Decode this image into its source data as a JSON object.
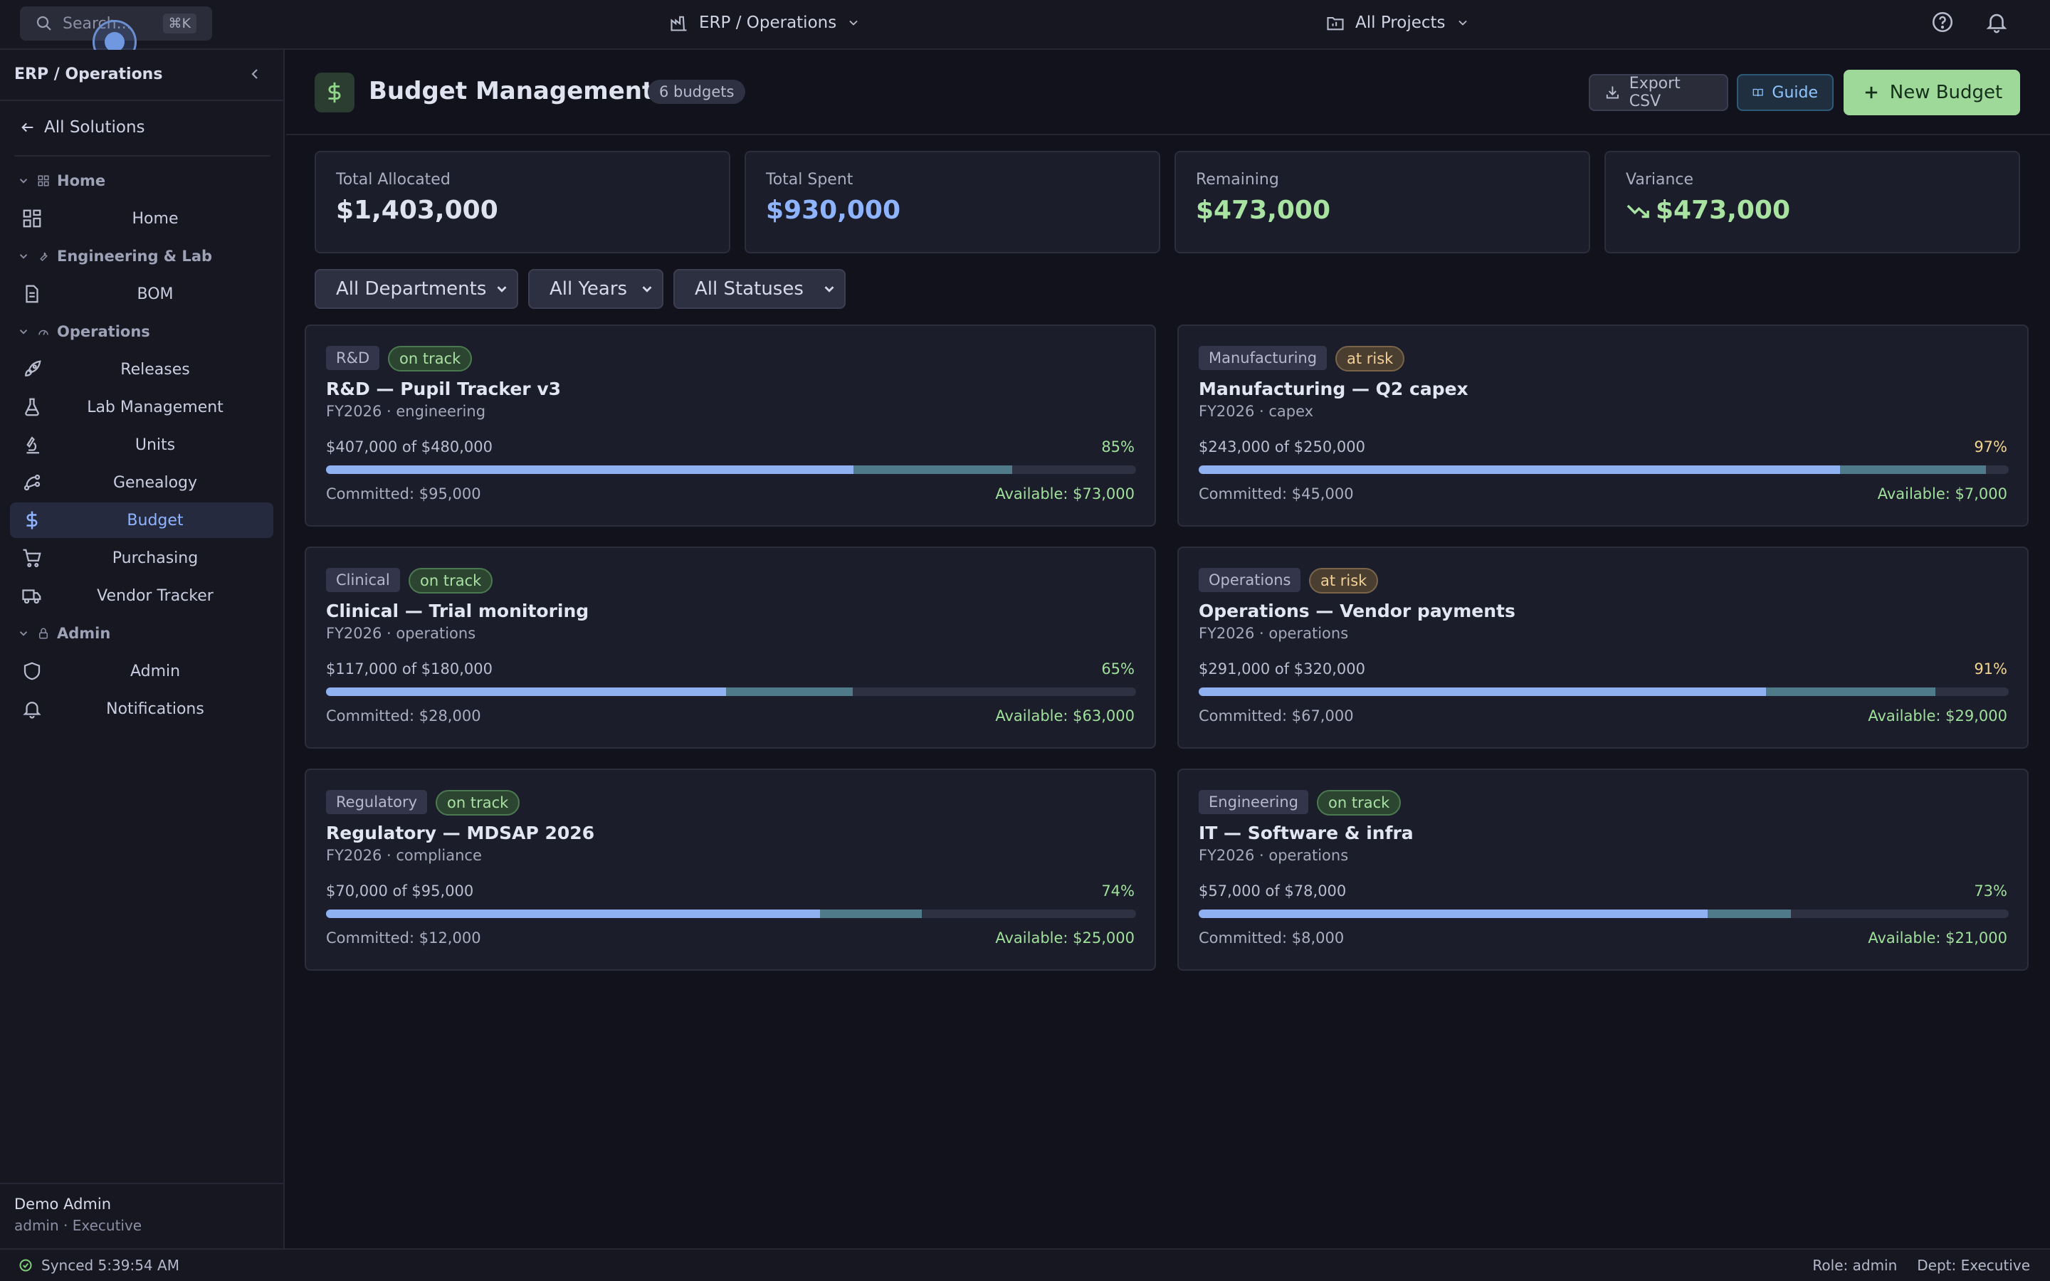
{
  "topbar": {
    "search_placeholder": "Search...",
    "search_shortcut": "⌘K",
    "solution_switcher": "ERP / Operations",
    "project_switcher": "All Projects"
  },
  "sidebar": {
    "title": "ERP / Operations",
    "back_label": "All Solutions",
    "groups": [
      {
        "label": "Home",
        "items": [
          {
            "label": "Home",
            "icon": "grid-icon"
          }
        ]
      },
      {
        "label": "Engineering & Lab",
        "items": [
          {
            "label": "BOM",
            "icon": "document-icon"
          }
        ]
      },
      {
        "label": "Operations",
        "items": [
          {
            "label": "Releases",
            "icon": "rocket-icon"
          },
          {
            "label": "Lab Management",
            "icon": "flask-icon"
          },
          {
            "label": "Units",
            "icon": "microscope-icon"
          },
          {
            "label": "Genealogy",
            "icon": "branch-icon"
          },
          {
            "label": "Budget",
            "icon": "dollar-icon",
            "active": true
          },
          {
            "label": "Purchasing",
            "icon": "cart-icon"
          },
          {
            "label": "Vendor Tracker",
            "icon": "truck-icon"
          }
        ]
      },
      {
        "label": "Admin",
        "items": [
          {
            "label": "Admin",
            "icon": "shield-icon"
          },
          {
            "label": "Notifications",
            "icon": "bell-icon"
          }
        ]
      }
    ],
    "user": {
      "name": "Demo Admin",
      "role": "admin · Executive"
    }
  },
  "header": {
    "title": "Budget Management",
    "count_badge": "6 budgets",
    "export_label": "Export CSV",
    "guide_label": "Guide",
    "new_label": "New Budget"
  },
  "stats": [
    {
      "label": "Total Allocated",
      "value": "$1,403,000",
      "color": "#dfe3f0"
    },
    {
      "label": "Total Spent",
      "value": "$930,000",
      "color": "#8fb4ff"
    },
    {
      "label": "Remaining",
      "value": "$473,000",
      "color": "#a8e3a2"
    },
    {
      "label": "Variance",
      "value": "$473,000",
      "color": "#a8e3a2",
      "icon": "trend-down-icon"
    }
  ],
  "filters": {
    "department": "All Departments",
    "year": "All Years",
    "status": "All Statuses"
  },
  "budgets": [
    {
      "dept": "R&D",
      "status": "on track",
      "title": "R&D — Pupil Tracker v3",
      "sub": "FY2026 · engineering",
      "amount": "$407,000 of $480,000",
      "pct": "85%",
      "spent_frac": 0.651,
      "committed_frac": 0.196,
      "committed": "Committed: $95,000",
      "available": "Available: $73,000"
    },
    {
      "dept": "Manufacturing",
      "status": "at risk",
      "title": "Manufacturing — Q2 capex",
      "sub": "FY2026 · capex",
      "amount": "$243,000 of $250,000",
      "pct": "97%",
      "spent_frac": 0.792,
      "committed_frac": 0.18,
      "committed": "Committed: $45,000",
      "available": "Available: $7,000"
    },
    {
      "dept": "Clinical",
      "status": "on track",
      "title": "Clinical — Trial monitoring",
      "sub": "FY2026 · operations",
      "amount": "$117,000 of $180,000",
      "pct": "65%",
      "spent_frac": 0.494,
      "committed_frac": 0.156,
      "committed": "Committed: $28,000",
      "available": "Available: $63,000"
    },
    {
      "dept": "Operations",
      "status": "at risk",
      "title": "Operations — Vendor payments",
      "sub": "FY2026 · operations",
      "amount": "$291,000 of $320,000",
      "pct": "91%",
      "spent_frac": 0.7,
      "committed_frac": 0.209,
      "committed": "Committed: $67,000",
      "available": "Available: $29,000"
    },
    {
      "dept": "Regulatory",
      "status": "on track",
      "title": "Regulatory — MDSAP 2026",
      "sub": "FY2026 · compliance",
      "amount": "$70,000 of $95,000",
      "pct": "74%",
      "spent_frac": 0.61,
      "committed_frac": 0.126,
      "committed": "Committed: $12,000",
      "available": "Available: $25,000"
    },
    {
      "dept": "Engineering",
      "status": "on track",
      "title": "IT — Software & infra",
      "sub": "FY2026 · operations",
      "amount": "$57,000 of $78,000",
      "pct": "73%",
      "spent_frac": 0.628,
      "committed_frac": 0.103,
      "committed": "Committed: $8,000",
      "available": "Available: $21,000"
    }
  ],
  "statusbar": {
    "sync": "Synced 5:39:54 AM",
    "role": "Role: admin",
    "dept": "Dept: Executive"
  }
}
